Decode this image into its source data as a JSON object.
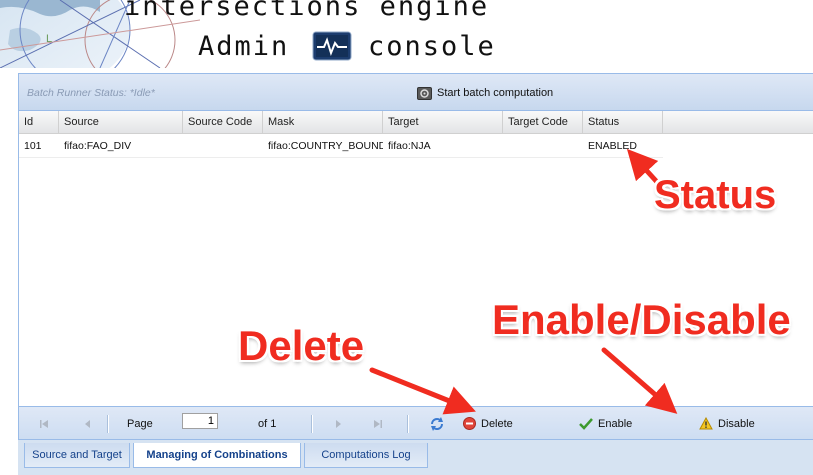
{
  "header": {
    "title_line1": "intersections engine",
    "title_line2_left": "Admin",
    "title_line2_right": "console"
  },
  "panel": {
    "runner_status": "Batch Runner Status: *Idle*",
    "batch_button_label": "Start batch computation"
  },
  "grid": {
    "columns": [
      "Id",
      "Source",
      "Source Code",
      "Mask",
      "Target",
      "Target Code",
      "Status"
    ],
    "rows": [
      {
        "id": "101",
        "source": "fifao:FAO_DIV",
        "source_code": "",
        "mask": "fifao:COUNTRY_BOUNDARIES",
        "target": "fifao:NJA",
        "target_code": "",
        "status": "ENABLED"
      }
    ]
  },
  "pager": {
    "page_label": "Page",
    "page_value": "1",
    "of_label": "of 1",
    "delete_label": "Delete",
    "enable_label": "Enable",
    "disable_label": "Disable"
  },
  "tabs": [
    {
      "label": "Source and Target",
      "active": false
    },
    {
      "label": "Managing of Combinations",
      "active": true
    },
    {
      "label": "Computations Log",
      "active": false
    }
  ],
  "annotations": {
    "status": "Status",
    "delete": "Delete",
    "enable_disable": "Enable/Disable"
  },
  "colors": {
    "annotation": "#f02c20",
    "panel_border": "#99bbe8"
  }
}
